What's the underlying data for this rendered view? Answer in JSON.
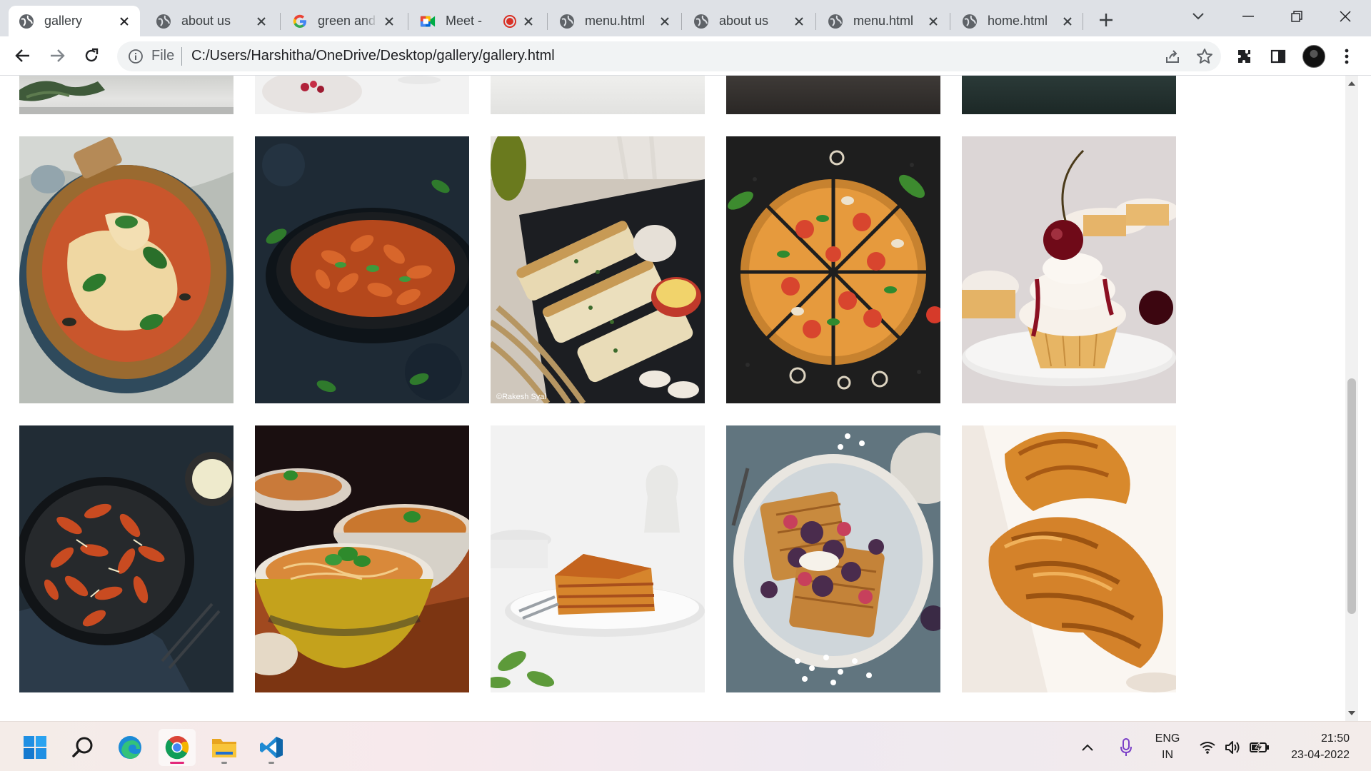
{
  "browser": {
    "tabs": [
      {
        "title": "gallery",
        "icon": "globe-icon",
        "active": true
      },
      {
        "title": "about us",
        "icon": "globe-icon"
      },
      {
        "title": "green and w",
        "icon": "google-icon"
      },
      {
        "title": "Meet -",
        "icon": "meet-icon",
        "recording": true
      },
      {
        "title": "menu.html",
        "icon": "globe-icon"
      },
      {
        "title": "about us",
        "icon": "globe-icon"
      },
      {
        "title": "menu.html",
        "icon": "globe-icon"
      },
      {
        "title": "home.html",
        "icon": "globe-icon"
      }
    ],
    "address": {
      "chip": "File",
      "url": "C:/Users/Harshitha/OneDrive/Desktop/gallery/gallery.html"
    }
  },
  "gallery": {
    "rows": [
      {
        "row": "top-partial",
        "items": [
          "greens",
          "berries-bowl",
          "light-table",
          "dark-table",
          "dark-green-table"
        ]
      },
      {
        "row": "middle",
        "items": [
          "margherita-pizza",
          "fusilli-pan",
          "garlic-bread",
          "sliced-pizza",
          "cherry-cupcake"
        ]
      },
      {
        "row": "bottom",
        "items": [
          "fusilli-plate",
          "spaghetti-bowls",
          "lasagna",
          "berry-waffles",
          "croissants"
        ]
      }
    ],
    "watermarks": {
      "garlic_bread": "©Rakesh Syal"
    }
  },
  "taskbar": {
    "apps": [
      "start-icon",
      "search-icon",
      "edge-icon",
      "chrome-icon",
      "file-explorer-icon",
      "vscode-icon"
    ],
    "language_top": "ENG",
    "language_bottom": "IN",
    "time": "21:50",
    "date": "23-04-2022"
  },
  "colors": {
    "tab_strip": "#dee1e6",
    "omnibox": "#f1f3f4",
    "chrome_blue": "#1a73e8"
  }
}
